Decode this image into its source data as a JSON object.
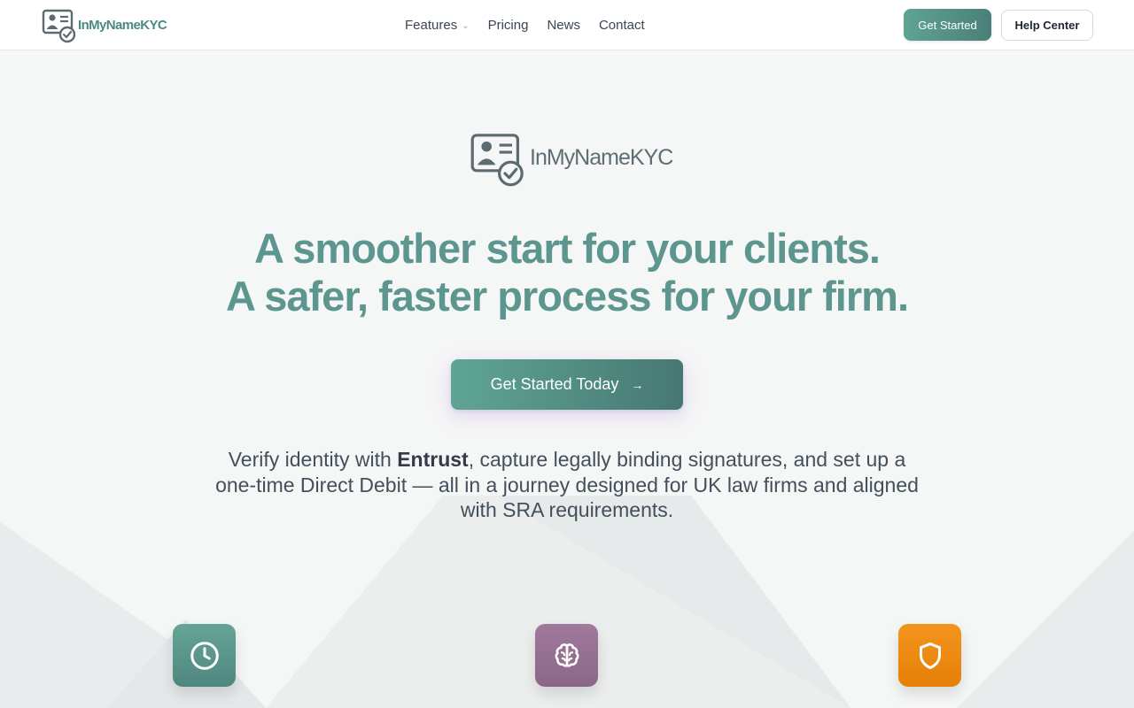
{
  "brand": {
    "name": "InMyNameKYC"
  },
  "nav": {
    "links": [
      {
        "label": "Features",
        "has_dropdown": true
      },
      {
        "label": "Pricing"
      },
      {
        "label": "News"
      },
      {
        "label": "Contact"
      }
    ],
    "get_started_label": "Get Started",
    "help_center_label": "Help Center"
  },
  "hero": {
    "headline_line1": "A smoother start for your clients.",
    "headline_line2": "A safer, faster process for your firm.",
    "cta_label": "Get Started Today",
    "cta_icon": "arrow-right-icon",
    "subtext_part1": "Verify identity with ",
    "subtext_bold": "Entrust",
    "subtext_part2": ", capture legally binding signatures, and set up a one-time Direct Debit — all in a journey designed for UK law firms and aligned with SRA requirements."
  },
  "features": [
    {
      "icon": "clock-icon",
      "color": "#5c998d"
    },
    {
      "icon": "brain-icon",
      "color": "#94708f"
    },
    {
      "icon": "shield-icon",
      "color": "#ee8a12"
    }
  ],
  "colors": {
    "accent": "#5c968e",
    "background": "#f5f6f6",
    "text": "#444f5c"
  }
}
